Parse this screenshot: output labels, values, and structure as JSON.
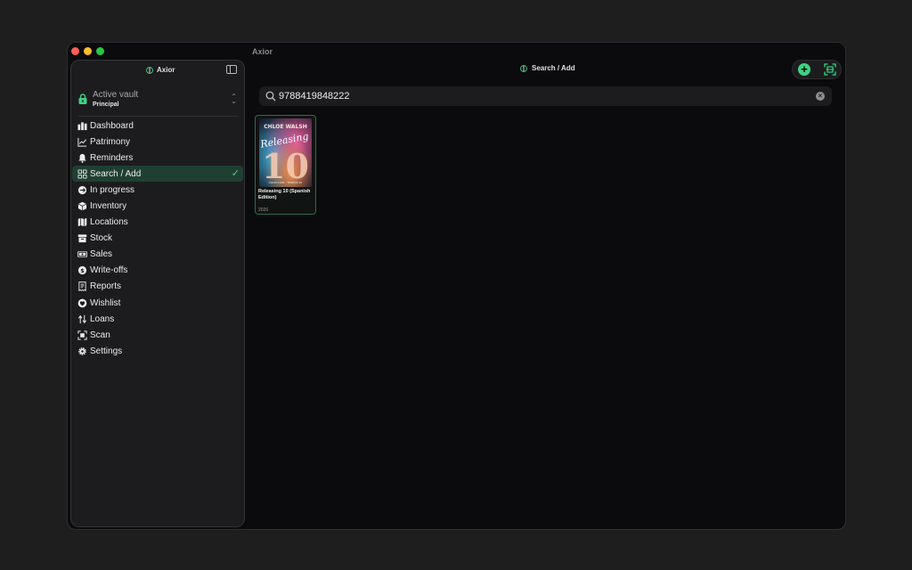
{
  "window": {
    "title": "Axior"
  },
  "sidebar": {
    "app_name": "Axior",
    "vault": {
      "title": "Active vault",
      "name": "Principal"
    },
    "items": [
      {
        "label": "Dashboard",
        "icon": "chart-bar-icon"
      },
      {
        "label": "Patrimony",
        "icon": "line-chart-icon"
      },
      {
        "label": "Reminders",
        "icon": "bell-icon"
      },
      {
        "label": "Search / Add",
        "icon": "grid-icon",
        "active": true
      },
      {
        "label": "In progress",
        "icon": "progress-icon"
      },
      {
        "label": "Inventory",
        "icon": "cube-icon"
      },
      {
        "label": "Locations",
        "icon": "map-icon"
      },
      {
        "label": "Stock",
        "icon": "archive-icon"
      },
      {
        "label": "Sales",
        "icon": "banknote-icon"
      },
      {
        "label": "Write-offs",
        "icon": "coin-icon"
      },
      {
        "label": "Reports",
        "icon": "receipt-icon"
      },
      {
        "label": "Wishlist",
        "icon": "heart-icon"
      },
      {
        "label": "Loans",
        "icon": "swap-icon"
      },
      {
        "label": "Scan",
        "icon": "scan-icon"
      },
      {
        "label": "Settings",
        "icon": "gear-icon"
      }
    ]
  },
  "main": {
    "title": "Search / Add",
    "search": {
      "value": "9788419848222",
      "placeholder": ""
    },
    "results": [
      {
        "title": "Releasing 10 (Spanish Edition)",
        "year": "2026",
        "cover": {
          "author": "CHLOE WALSH",
          "script": "Releasing",
          "number": "10",
          "series": "COLECCIÓN · TERROR 95"
        }
      }
    ]
  },
  "colors": {
    "accent": "#3fd181",
    "active_bg": "#1f3f33",
    "background": "#0b0b0d",
    "sidebar_bg": "#1c1c1e"
  }
}
